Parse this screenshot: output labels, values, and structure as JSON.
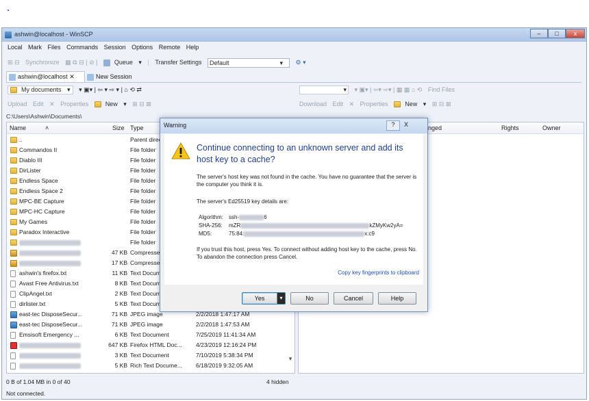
{
  "window": {
    "title": "ashwin@localhost - WinSCP",
    "controls": [
      "–",
      "□",
      "x"
    ]
  },
  "menu": [
    "Local",
    "Mark",
    "Files",
    "Commands",
    "Session",
    "Options",
    "Remote",
    "Help"
  ],
  "toolbar1": {
    "synchronize": "Synchronize",
    "queue": "Queue",
    "transfer_settings_label": "Transfer Settings",
    "transfer_settings_value": "Default"
  },
  "session_tabs": [
    "ashwin@localhost",
    "New Session"
  ],
  "left_nav": {
    "location": "My documents"
  },
  "left_actions": {
    "upload": "Upload",
    "edit": "Edit",
    "properties": "Properties",
    "new": "New"
  },
  "right_actions": {
    "download": "Download",
    "edit": "Edit",
    "properties": "Properties",
    "new": "New",
    "find_files": "Find Files"
  },
  "left_path": "C:\\Users\\Ashwin\\Documents\\",
  "left_columns": [
    "Name",
    "Size",
    "Type"
  ],
  "right_columns": [
    "anged",
    "Rights",
    "Owner"
  ],
  "left_rows": [
    {
      "name": "..",
      "size": "",
      "type": "Parent direc",
      "date": "",
      "icon": "up"
    },
    {
      "name": "Commandos II",
      "size": "",
      "type": "File folder",
      "date": "",
      "icon": "folder"
    },
    {
      "name": "Diablo III",
      "size": "",
      "type": "File folder",
      "date": "",
      "icon": "folder"
    },
    {
      "name": "DirLister",
      "size": "",
      "type": "File folder",
      "date": "",
      "icon": "folder"
    },
    {
      "name": "Endless Space",
      "size": "",
      "type": "File folder",
      "date": "",
      "icon": "folder"
    },
    {
      "name": "Endless Space 2",
      "size": "",
      "type": "File folder",
      "date": "",
      "icon": "folder"
    },
    {
      "name": "MPC-BE Capture",
      "size": "",
      "type": "File folder",
      "date": "",
      "icon": "folder"
    },
    {
      "name": "MPC-HC Capture",
      "size": "",
      "type": "File folder",
      "date": "",
      "icon": "folder"
    },
    {
      "name": "My Games",
      "size": "",
      "type": "File folder",
      "date": "",
      "icon": "folder"
    },
    {
      "name": "Paradox Interactive",
      "size": "",
      "type": "File folder",
      "date": "",
      "icon": "folder"
    },
    {
      "name": "",
      "size": "",
      "type": "File folder",
      "date": "",
      "icon": "folder"
    },
    {
      "name": "",
      "size": "47 KB",
      "type": "Compresse",
      "date": "",
      "icon": "zip"
    },
    {
      "name": "",
      "size": "17 KB",
      "type": "Compresse",
      "date": "",
      "icon": "zip"
    },
    {
      "name": "ashwin's firefox.txt",
      "size": "11 KB",
      "type": "Text Docum",
      "date": "",
      "icon": "file"
    },
    {
      "name": "Avast Free Antivirus.txt",
      "size": "8 KB",
      "type": "Text Docum",
      "date": "",
      "icon": "file"
    },
    {
      "name": "ClipAngel.txt",
      "size": "2 KB",
      "type": "Text Docum",
      "date": "",
      "icon": "file"
    },
    {
      "name": "dirlister.txt",
      "size": "5 KB",
      "type": "Text Docum",
      "date": "",
      "icon": "file"
    },
    {
      "name": "east-tec DisposeSecur...",
      "size": "71 KB",
      "type": "JPEG image",
      "date": "2/2/2018  1:47:17 AM",
      "icon": "img"
    },
    {
      "name": "east-tec DisposeSecur...",
      "size": "71 KB",
      "type": "JPEG image",
      "date": "2/2/2018  1:47:53 AM",
      "icon": "img"
    },
    {
      "name": "Emsisoft Emergency ...",
      "size": "6 KB",
      "type": "Text Document",
      "date": "7/25/2019  11:41:34 AM",
      "icon": "file"
    },
    {
      "name": "",
      "size": "647 KB",
      "type": "Firefox HTML Doc...",
      "date": "4/23/2019  12:16:24 PM",
      "icon": "html"
    },
    {
      "name": "",
      "size": "3 KB",
      "type": "Text Document",
      "date": "7/10/2019  5:38:34 PM",
      "icon": "file"
    },
    {
      "name": "",
      "size": "5 KB",
      "type": "Rich Text Docume...",
      "date": "6/18/2019  9:32:05 AM",
      "icon": "file"
    }
  ],
  "status": {
    "left": "0 B of 1.04 MB in 0 of 40",
    "hidden": "4 hidden",
    "connection": "Not connected."
  },
  "dialog": {
    "title": "Warning",
    "help_glyph": "?",
    "close_glyph": "X",
    "heading": "Continue connecting to an unknown server and add its host key to a cache?",
    "p1": "The server's host key was not found in the cache. You have no guarantee that the server is the computer you think it is.",
    "p2": "The server's Ed25519 key details are:",
    "algorithm_label": "Algorithm:",
    "algorithm_value": "ssh-",
    "algorithm_tail": "6",
    "sha_label": "SHA-256:",
    "sha_value": "mZR",
    "sha_tail": "kZMyKw2yA=",
    "md5_label": "MD5:",
    "md5_value": "75:84:",
    "md5_tail": "x:c9",
    "p3": "If you trust this host, press Yes. To connect without adding host key to the cache, press No. To abandon the connection press Cancel.",
    "copy_link": "Copy key fingerprints to clipboard",
    "buttons": {
      "yes": "Yes",
      "no": "No",
      "cancel": "Cancel",
      "help": "Help"
    }
  }
}
